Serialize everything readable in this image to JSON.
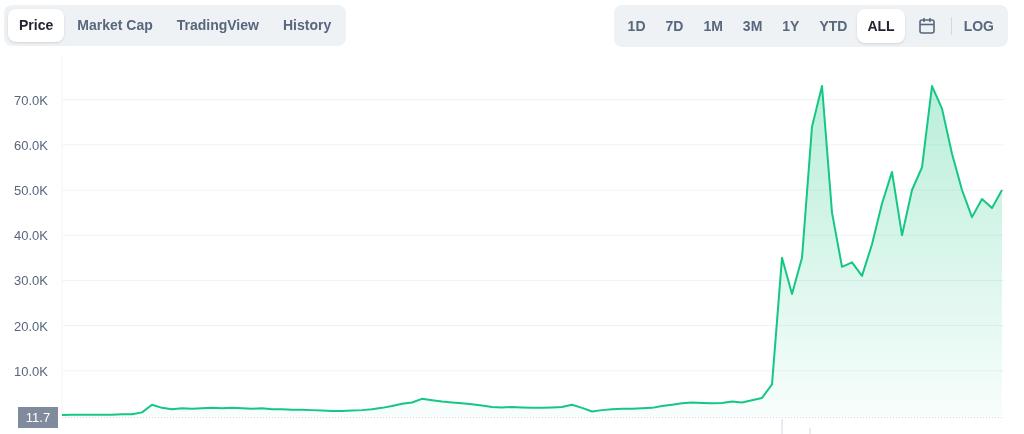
{
  "tabs": [
    {
      "label": "Price",
      "selected": true
    },
    {
      "label": "Market Cap",
      "selected": false
    },
    {
      "label": "TradingView",
      "selected": false
    },
    {
      "label": "History",
      "selected": false
    }
  ],
  "ranges": [
    {
      "label": "1D",
      "selected": false
    },
    {
      "label": "7D",
      "selected": false
    },
    {
      "label": "1M",
      "selected": false
    },
    {
      "label": "3M",
      "selected": false
    },
    {
      "label": "1Y",
      "selected": false
    },
    {
      "label": "YTD",
      "selected": false
    },
    {
      "label": "ALL",
      "selected": true
    }
  ],
  "scale_toggle": {
    "label": "LOG",
    "selected": false
  },
  "chart": {
    "price_label": "11.7",
    "chart_data": {
      "type": "area",
      "ylim": [
        0,
        80000
      ],
      "grid": true,
      "yticks": [
        {
          "value": 10000,
          "label": "10.0K"
        },
        {
          "value": 20000,
          "label": "20.0K"
        },
        {
          "value": 30000,
          "label": "30.0K"
        },
        {
          "value": 40000,
          "label": "40.0K"
        },
        {
          "value": 50000,
          "label": "50.0K"
        },
        {
          "value": 60000,
          "label": "60.0K"
        },
        {
          "value": 70000,
          "label": "70.0K"
        }
      ],
      "series": [
        {
          "color": "#16c784",
          "values": [
            200,
            300,
            300,
            300,
            300,
            300,
            400,
            400,
            800,
            2500,
            1800,
            1500,
            1700,
            1600,
            1700,
            1800,
            1700,
            1800,
            1700,
            1600,
            1700,
            1500,
            1500,
            1400,
            1400,
            1300,
            1200,
            1100,
            1100,
            1200,
            1300,
            1500,
            1800,
            2200,
            2700,
            3000,
            3800,
            3500,
            3200,
            3000,
            2800,
            2600,
            2300,
            2000,
            1900,
            2000,
            1900,
            1800,
            1800,
            1900,
            2000,
            2500,
            1800,
            1000,
            1300,
            1500,
            1600,
            1600,
            1700,
            1800,
            2200,
            2500,
            2800,
            3000,
            2900,
            2800,
            2900,
            3200,
            3000,
            3500,
            4000,
            7000,
            35000,
            27000,
            35000,
            64000,
            73000,
            45000,
            33000,
            34000,
            31000,
            38000,
            47000,
            54000,
            40000,
            50000,
            55000,
            73000,
            68000,
            58000,
            50000,
            44000,
            48000,
            46000,
            50000
          ]
        }
      ]
    }
  }
}
